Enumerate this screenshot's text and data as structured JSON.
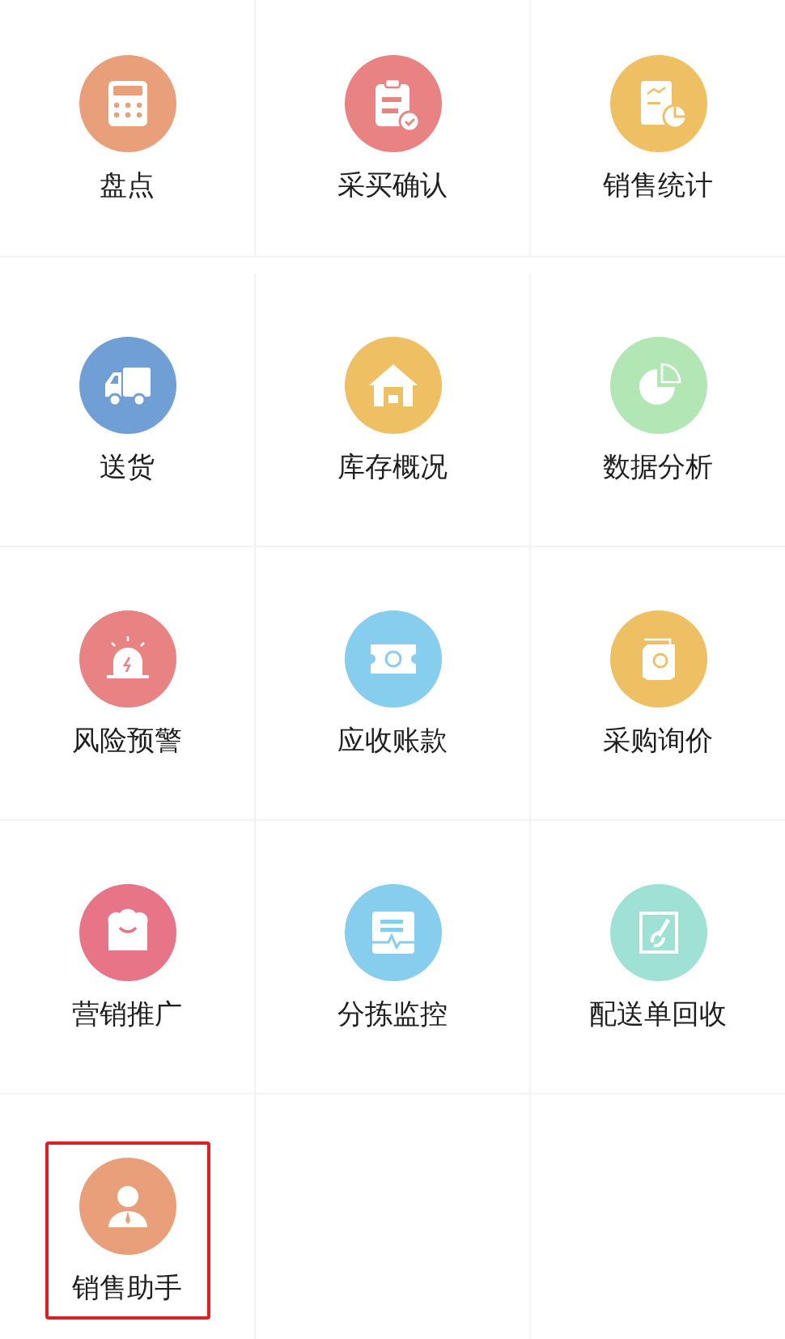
{
  "tiles": [
    {
      "label": "盘点",
      "kind": "calculator",
      "color": "#e9a07a",
      "selected": false
    },
    {
      "label": "采买确认",
      "kind": "clipboard",
      "color": "#e98282",
      "selected": false
    },
    {
      "label": "销售统计",
      "kind": "report",
      "color": "#efc063",
      "selected": false
    },
    {
      "label": "送货",
      "kind": "truck",
      "color": "#6f9fd4",
      "selected": false
    },
    {
      "label": "库存概况",
      "kind": "warehouse",
      "color": "#efc063",
      "selected": false
    },
    {
      "label": "数据分析",
      "kind": "pie",
      "color": "#b3e6b5",
      "selected": false
    },
    {
      "label": "风险预警",
      "kind": "alarm",
      "color": "#e98282",
      "selected": false
    },
    {
      "label": "应收账款",
      "kind": "ticket",
      "color": "#86cdee",
      "selected": false
    },
    {
      "label": "采购询价",
      "kind": "bills",
      "color": "#efc063",
      "selected": false
    },
    {
      "label": "营销推广",
      "kind": "basket",
      "color": "#e87487",
      "selected": false
    },
    {
      "label": "分拣监控",
      "kind": "monitor",
      "color": "#86cdee",
      "selected": false
    },
    {
      "label": "配送单回收",
      "kind": "recycle",
      "color": "#9fe2d5",
      "selected": false
    },
    {
      "label": "销售助手",
      "kind": "person",
      "color": "#e9a07a",
      "selected": true
    }
  ]
}
